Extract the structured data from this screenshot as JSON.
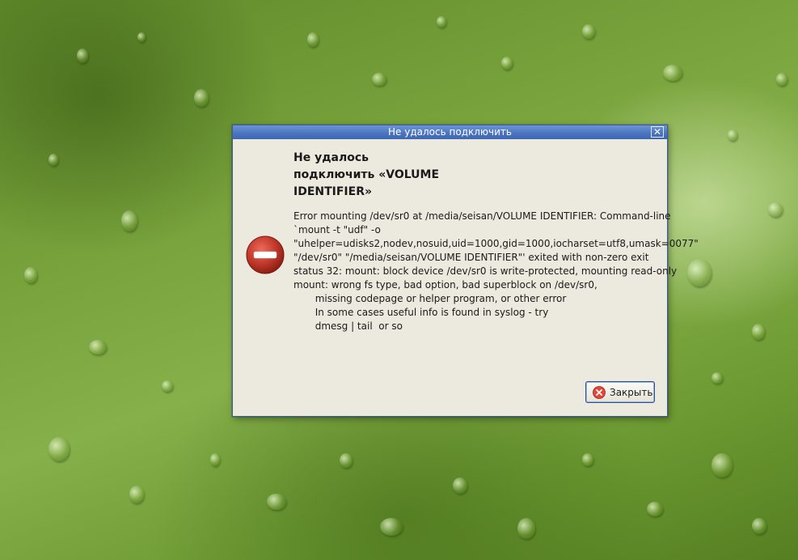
{
  "dialog": {
    "title": "Не удалось подключить",
    "close_glyph": "✕",
    "heading": "Не удалось\nподключить «VOLUME\nIDENTIFIER»",
    "message": "Error mounting /dev/sr0 at /media/seisan/VOLUME IDENTIFIER: Command-line\n`mount -t \"udf\" -o\n\"uhelper=udisks2,nodev,nosuid,uid=1000,gid=1000,iocharset=utf8,umask=0077\"\n\"/dev/sr0\" \"/media/seisan/VOLUME IDENTIFIER\"' exited with non-zero exit\nstatus 32: mount: block device /dev/sr0 is write-protected, mounting read-only\nmount: wrong fs type, bad option, bad superblock on /dev/sr0,\n       missing codepage or helper program, or other error\n       In some cases useful info is found in syslog - try\n       dmesg | tail  or so",
    "close_button_label": "Закрыть",
    "icon": "error-icon",
    "accent_color": "#4a73bf",
    "error_color": "#c0392b"
  }
}
